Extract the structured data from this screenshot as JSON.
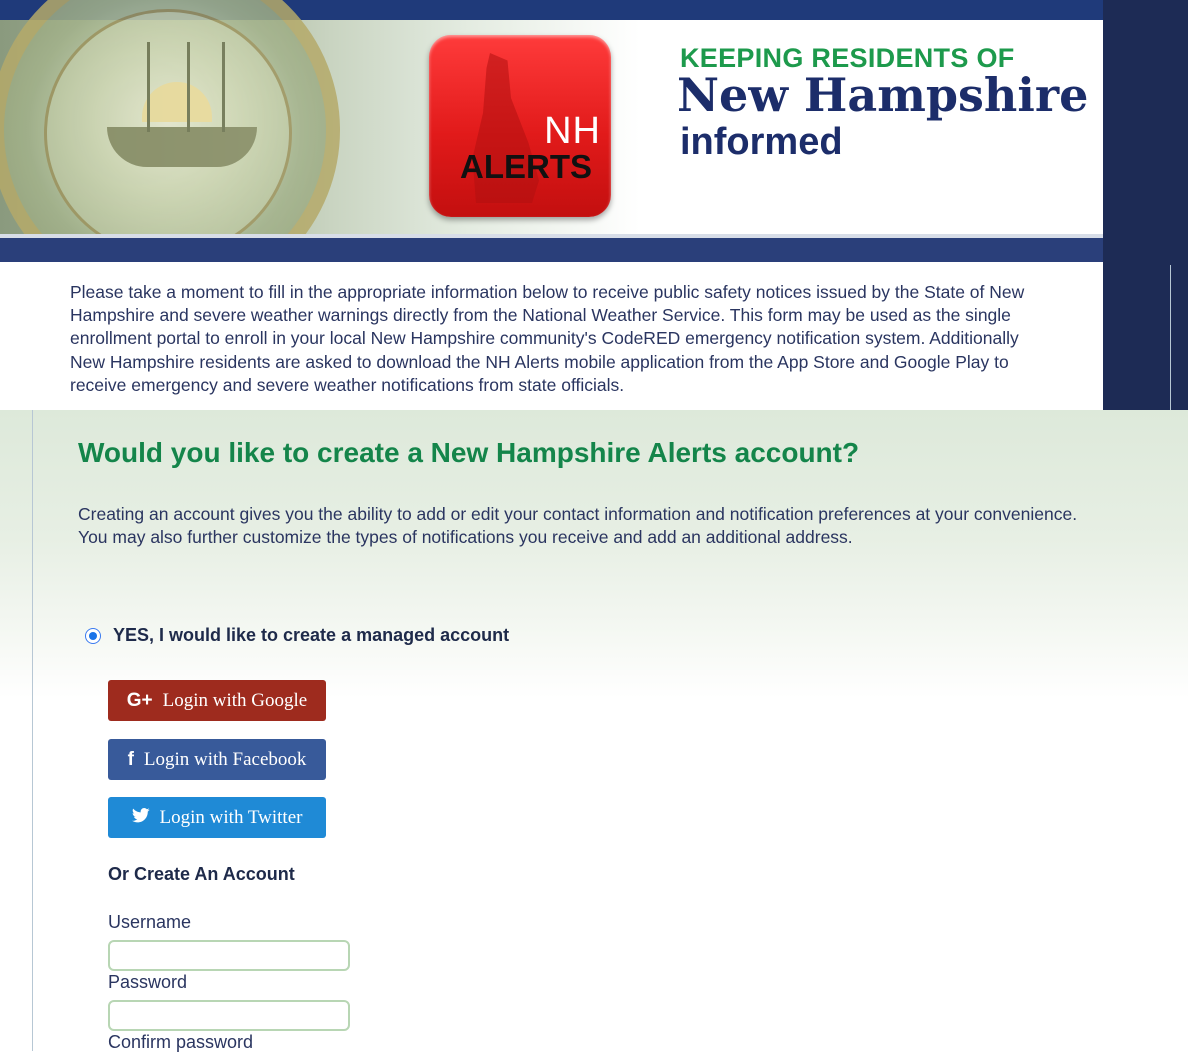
{
  "header": {
    "logo": {
      "nh": "NH",
      "alerts": "ALERTS"
    },
    "tagline": {
      "line1": "KEEPING RESIDENTS OF",
      "line2": "New Hampshire",
      "line3": "informed"
    }
  },
  "intro": {
    "lines": [
      "Please take a moment to fill in the appropriate information below to receive public safety notices issued by the State of New",
      "Hampshire and severe weather warnings directly from the National Weather Service. This form may be used as the single",
      "enrollment portal to enroll in your local New Hampshire community's CodeRED emergency notification system. Additionally",
      "New Hampshire residents are asked to download the NH Alerts mobile application from the App Store and Google Play to",
      "receive emergency and severe weather notifications from state officials."
    ]
  },
  "account": {
    "title": "Would you like to create a New Hampshire Alerts account?",
    "desc1": "Creating an account gives you the ability to add or edit your contact information and notification preferences at your convenience.",
    "desc2": "You may also further customize the types of notifications you receive and add an additional address.",
    "radio_yes_label": "YES, I would like to create a managed account",
    "radio_yes_checked": true,
    "social": {
      "google": {
        "icon": "G+",
        "label": "Login with Google"
      },
      "facebook": {
        "icon": "f",
        "label": "Login with Facebook"
      },
      "twitter": {
        "icon": "🐦",
        "label": "Login with Twitter"
      }
    },
    "or_create": "Or Create An Account",
    "fields": {
      "username": {
        "label": "Username",
        "value": ""
      },
      "password": {
        "label": "Password",
        "value": ""
      },
      "confirm_password": {
        "label": "Confirm password"
      }
    }
  },
  "colors": {
    "navy": "#1d2b55",
    "green_title": "#14854a",
    "google": "#9e2b1e",
    "facebook": "#385a9a",
    "twitter": "#1f8ad6",
    "logo_red": "#e11a1a"
  }
}
